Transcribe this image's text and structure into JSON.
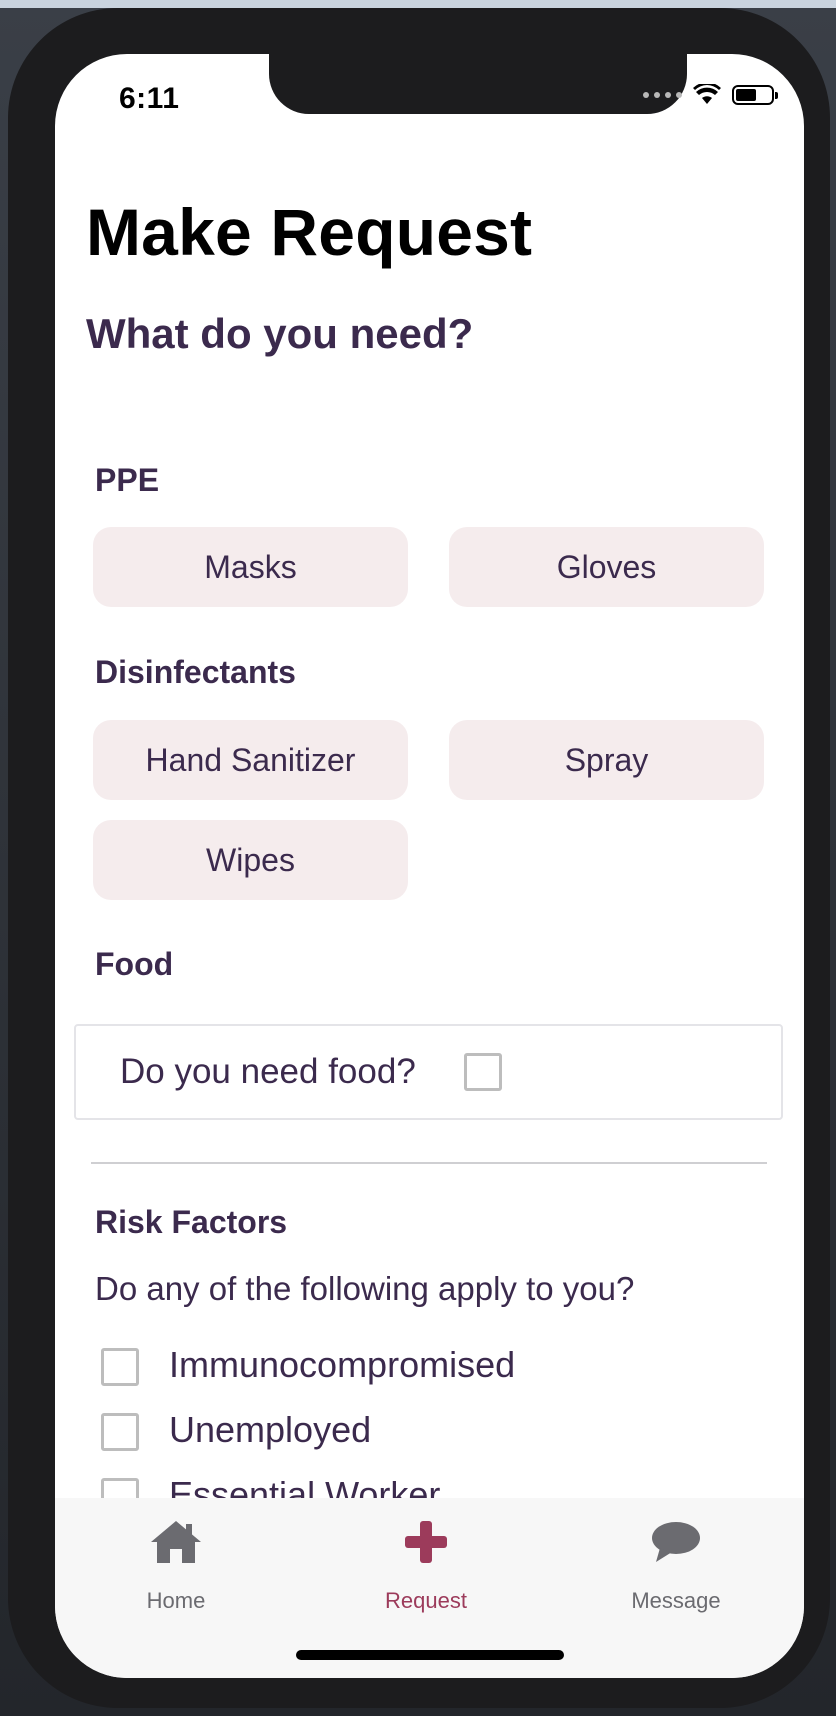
{
  "status_bar": {
    "time": "6:11",
    "icons": [
      "signal-dots-icon",
      "wifi-icon",
      "battery-icon"
    ]
  },
  "page": {
    "title": "Make Request",
    "subtitle": "What do you need?"
  },
  "sections": {
    "ppe": {
      "label": "PPE",
      "options": [
        "Masks",
        "Gloves"
      ]
    },
    "disinfectants": {
      "label": "Disinfectants",
      "options": [
        "Hand Sanitizer",
        "Spray",
        "Wipes"
      ]
    },
    "food": {
      "label": "Food",
      "question": "Do you need food?",
      "checked": false
    },
    "risk": {
      "label": "Risk Factors",
      "question": "Do any of the following apply to you?",
      "options": [
        "Immunocompromised",
        "Unemployed",
        "Essential Worker"
      ]
    }
  },
  "tabbar": {
    "tabs": [
      {
        "label": "Home",
        "icon": "home-icon",
        "active": false
      },
      {
        "label": "Request",
        "icon": "plus-icon",
        "active": true
      },
      {
        "label": "Message",
        "icon": "chat-bubble-icon",
        "active": false
      }
    ]
  },
  "colors": {
    "accent": "#9c3b5b",
    "heading": "#3b2a4d",
    "chip_bg": "#f5eced",
    "tabbar_bg": "#f7f7f7"
  }
}
